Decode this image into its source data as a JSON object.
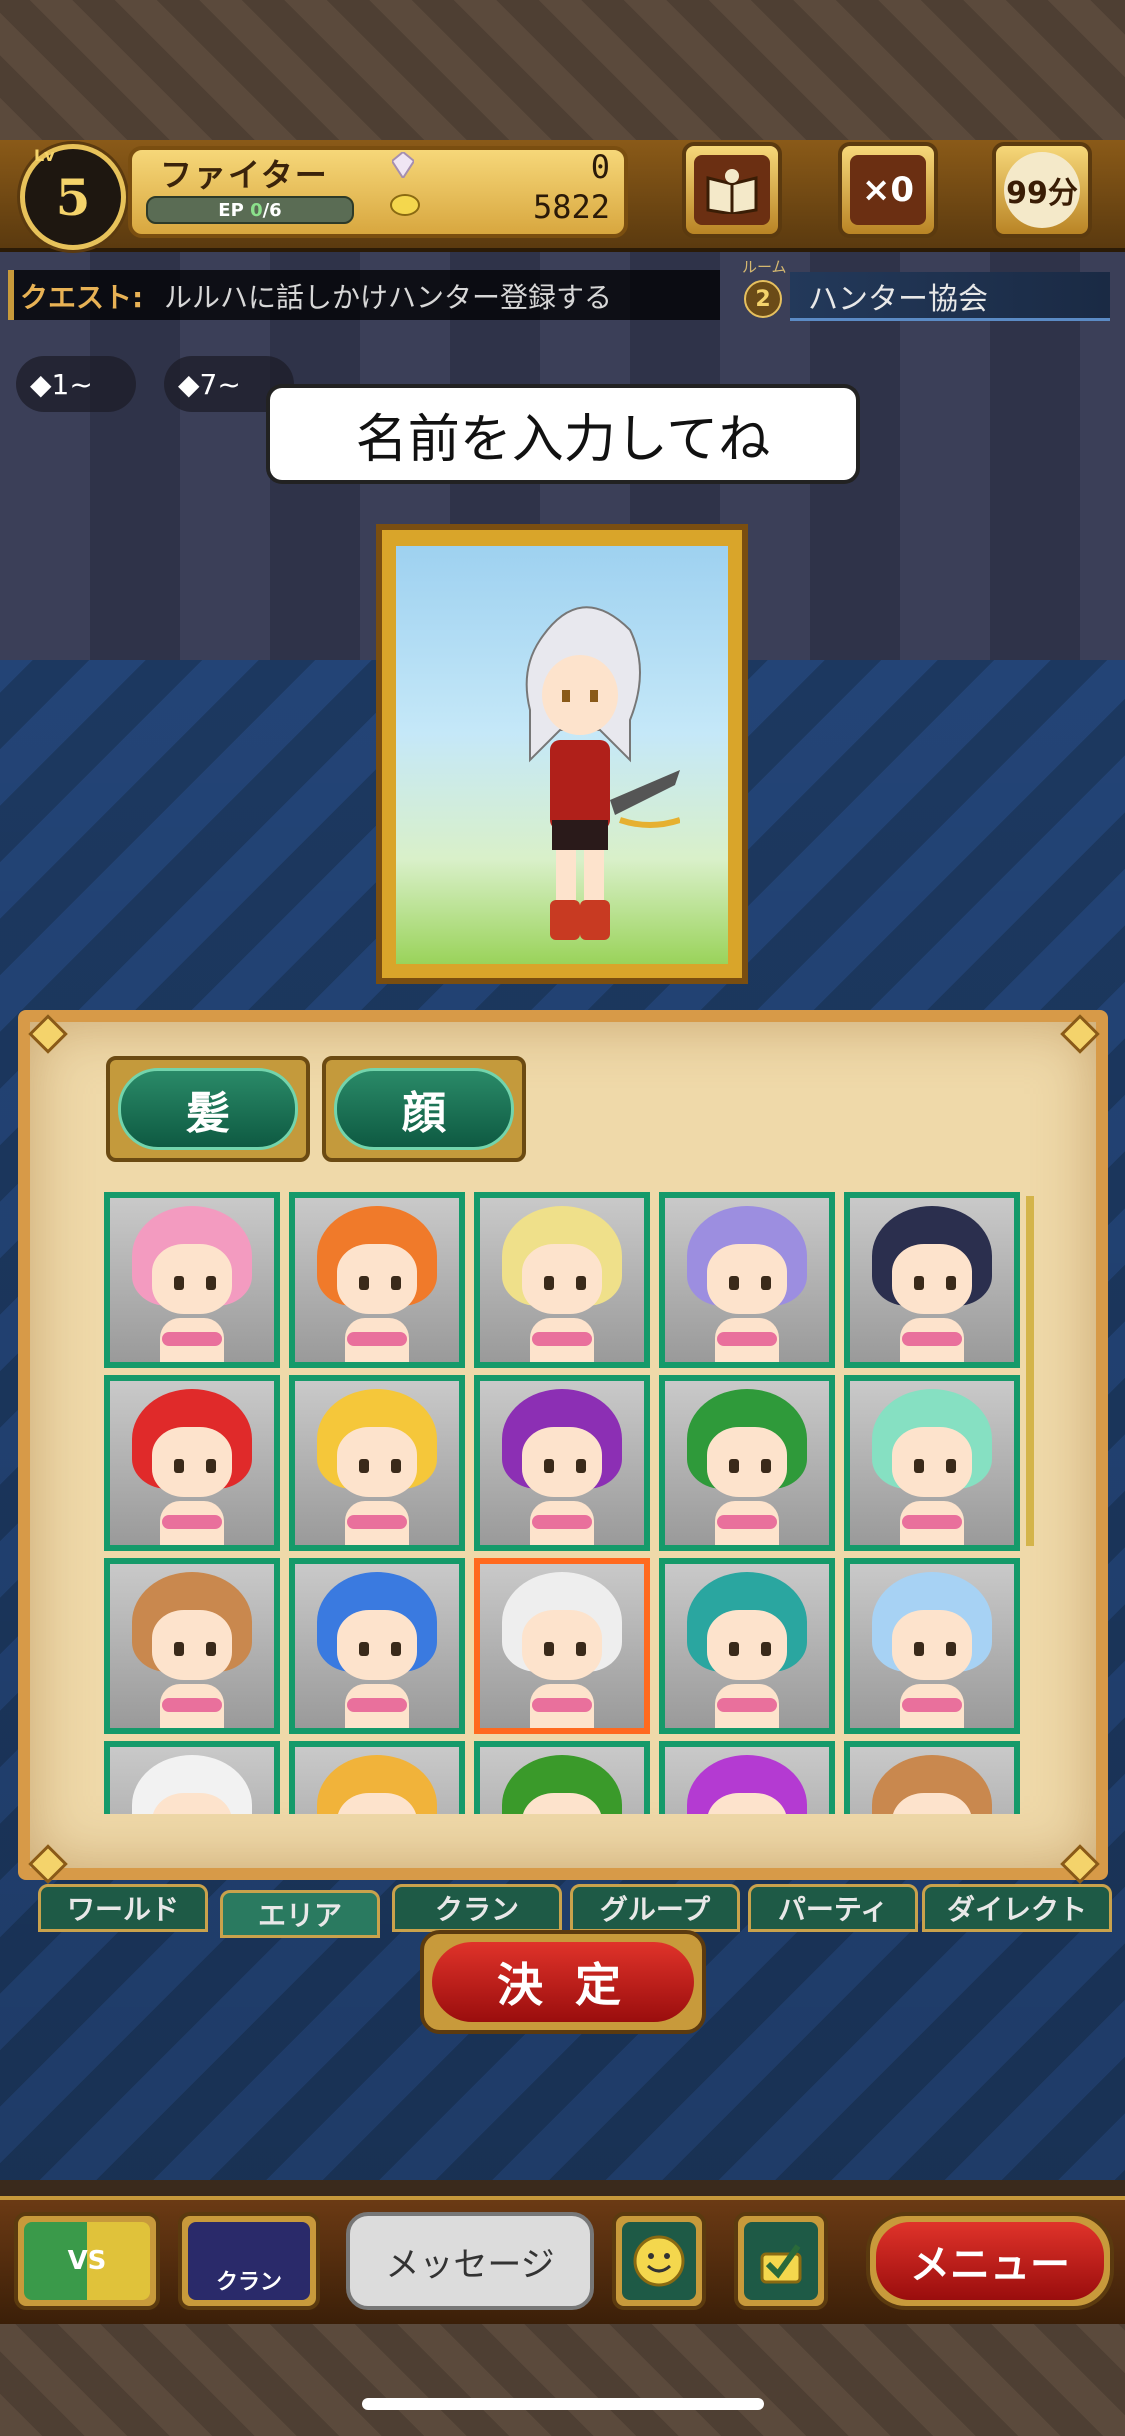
{
  "status": {
    "level_label": "Lv",
    "level": "5",
    "class_name": "ファイター",
    "ep_label": "EP",
    "ep_value": "0",
    "ep_max": "/6",
    "gems": "0",
    "gold": "5822",
    "ticket_count": "×0",
    "timer": "99分"
  },
  "quest": {
    "label": "クエスト:",
    "text": "ルルハに話しかけハンター登録する",
    "room_label": "ルーム",
    "room_number": "2",
    "location": "ハンター協会"
  },
  "chips": [
    "1~",
    "7~"
  ],
  "prompt": "名前を入力してね",
  "tabs": {
    "hair": "髪",
    "face": "顔"
  },
  "hair_colors": [
    "#f39bc0",
    "#f07a2a",
    "#efe08a",
    "#9c8ee0",
    "#2b2f4e",
    "#e02a2a",
    "#f5c73a",
    "#8c2fb4",
    "#2f9a3a",
    "#86e0c2",
    "#c9884e",
    "#3a7ae0",
    "#eeeeee",
    "#2aa6a0",
    "#a7d2f4",
    "#f2f2f2",
    "#f1b33a",
    "#3a9a2a",
    "#b43ad2",
    "#c9884e"
  ],
  "selected_index": 12,
  "chat_tabs": [
    "ワールド",
    "エリア",
    "クラン",
    "グループ",
    "パーティ",
    "ダイレクト"
  ],
  "confirm": "決 定",
  "toolbar": {
    "vs": "VS",
    "clan": "クラン",
    "message": "メッセージ",
    "menu": "メニュー"
  }
}
